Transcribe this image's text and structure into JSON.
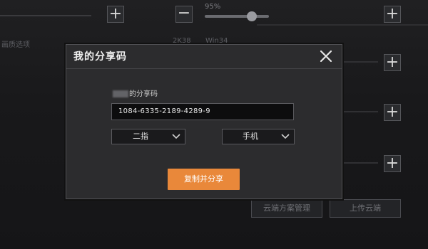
{
  "background": {
    "percent_label": "95%",
    "resolution_text": "2K38",
    "os_text": "Win34",
    "side_label": "画质选项",
    "cloud_manage_button": "云端方案管理",
    "upload_cloud_button": "上传云端"
  },
  "dialog": {
    "title": "我的分享码",
    "code_label": "的分享码",
    "share_code": "1084-6335-2189-4289-9",
    "select_left_value": "二指",
    "select_right_value": "手机",
    "copy_share_button": "复制并分享"
  },
  "colors": {
    "accent": "#e9883a",
    "dialog_bg": "#2c2c2e",
    "page_bg": "#1a1a1c"
  }
}
